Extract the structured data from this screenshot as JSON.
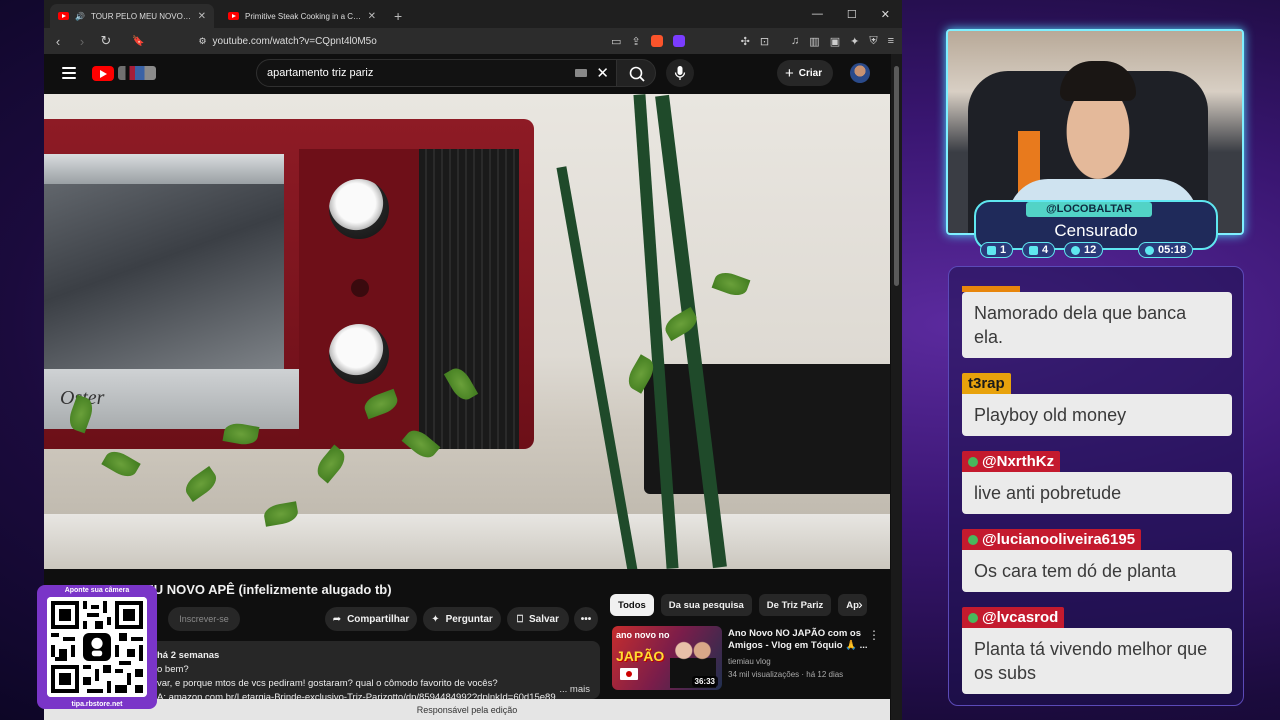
{
  "browser": {
    "tabs": [
      {
        "label": "TOUR PELO MEU NOVO APÊ (infelizm",
        "active": true
      },
      {
        "label": "Primitive Steak Cooking in a Clay Oven Buil",
        "active": false
      }
    ],
    "url": "youtube.com/watch?v=CQpnt4l0M5o"
  },
  "youtube": {
    "search_value": "apartamento triz pariz",
    "create_label": "Criar",
    "video_title": "TOUR PELO MEU NOVO APÊ (infelizmente alugado tb)",
    "subscribe_label": "Inscrever-se",
    "actions": {
      "share": "Compartilhar",
      "ask": "Perguntar",
      "save": "Salvar"
    },
    "description": {
      "date": "há 2 semanas",
      "line1": "o bem?",
      "line2": "var, e porque mtos de vcs pediram! gostaram? qual o cômodo favorito de vocês?",
      "line3": "A: amazon.com.br/Letargia-Brinde-exclusivo-Triz-Parizotto/dp/8594484992?dplnkId=60d15e89",
      "more": "... mais"
    },
    "chips": [
      "Todos",
      "Da sua pesquisa",
      "De Triz Pariz",
      "Ap"
    ],
    "recommendation": {
      "thumb_top": "ano novo no",
      "thumb_big": "JAPÃO",
      "duration": "36:33",
      "title": "Ano Novo NO JAPÃO com os Amigos - Vlog em Tóquio 🙏 ...",
      "channel": "tiemiau vlog",
      "meta": "34 mil visualizações · há 12 dias"
    },
    "footer": "Responsável pela edição"
  },
  "qr": {
    "top": "Aponte sua câmera",
    "bottom": "tipa.rbstore.net"
  },
  "stream": {
    "username": "@LOCOBALTAR",
    "status": "Censurado",
    "stats": [
      {
        "icon": "chat-icon",
        "value": "1"
      },
      {
        "icon": "youtube-icon",
        "value": "4"
      },
      {
        "icon": "kick-icon",
        "value": "12"
      },
      {
        "icon": "clock-icon",
        "value": "05:18"
      }
    ]
  },
  "chat": [
    {
      "user": "",
      "text": "Namorado dela que banca ela.",
      "user_bg": "#e8860c"
    },
    {
      "user": "t3rap",
      "text": "Playboy old money",
      "user_bg": "#e8a20c"
    },
    {
      "user": "@NxrthKz",
      "text": "live anti pobretude",
      "user_bg": "#c41a2e"
    },
    {
      "user": "@lucianooliveira6195",
      "text": "Os cara tem dó de planta",
      "user_bg": "#c41a2e"
    },
    {
      "user": "@lvcasrod",
      "text": "Planta tá vivendo melhor que os subs",
      "user_bg": "#c41a2e"
    }
  ],
  "colors": {
    "youtube_red": "#ff0000",
    "overlay_cyan": "#5fe7f0",
    "overlay_purple": "#7a35c8"
  }
}
